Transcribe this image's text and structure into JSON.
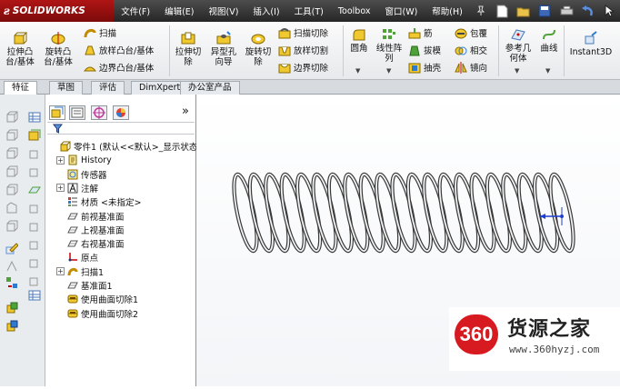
{
  "app": {
    "logo_text": "SOLIDWORKS",
    "menus": [
      "文件(F)",
      "编辑(E)",
      "视图(V)",
      "插入(I)",
      "工具(T)",
      "Toolbox",
      "窗口(W)",
      "帮助(H)"
    ]
  },
  "ribbon": {
    "extrude_boss": "拉伸凸\n台/基体",
    "revolve_boss": "旋转凸\n台/基体",
    "sweep": "扫描",
    "loft_boss": "放样凸台/基体",
    "boundary_boss": "边界凸台/基体",
    "extrude_cut": "拉伸切\n除",
    "hole_wizard": "异型孔\n向导",
    "revolve_cut": "旋转切\n除",
    "sweep_cut": "扫描切除",
    "loft_cut": "放样切割",
    "boundary_cut": "边界切除",
    "fillet": "圆角",
    "linear_pattern": "线性阵\n列",
    "rib": "筋",
    "draft": "拔模",
    "shell": "抽壳",
    "wrap": "包覆",
    "intersect": "相交",
    "mirror": "镜向",
    "ref_geometry": "参考几\n何体",
    "curves": "曲线",
    "instant3d": "Instant3D"
  },
  "tabs": [
    "特征",
    "草图",
    "评估",
    "DimXpert",
    "办公室产品"
  ],
  "panel": {
    "expand_glyph": "»",
    "tree": [
      {
        "label": "零件1  (默认<<默认>_显示状态",
        "icon": "part-icon",
        "expand": "",
        "indent": 0
      },
      {
        "label": "History",
        "icon": "history-icon",
        "expand": "+",
        "indent": 1
      },
      {
        "label": "传感器",
        "icon": "sensor-icon",
        "expand": "",
        "indent": 1
      },
      {
        "label": "注解",
        "icon": "annotation-icon",
        "expand": "+",
        "indent": 1
      },
      {
        "label": "材质 <未指定>",
        "icon": "material-icon",
        "expand": "",
        "indent": 1
      },
      {
        "label": "前视基准面",
        "icon": "plane-icon",
        "expand": "",
        "indent": 1
      },
      {
        "label": "上视基准面",
        "icon": "plane-icon",
        "expand": "",
        "indent": 1
      },
      {
        "label": "右视基准面",
        "icon": "plane-icon",
        "expand": "",
        "indent": 1
      },
      {
        "label": "原点",
        "icon": "origin-icon",
        "expand": "",
        "indent": 1
      },
      {
        "label": "扫描1",
        "icon": "sweep-feature-icon",
        "expand": "+",
        "indent": 1
      },
      {
        "label": "基准面1",
        "icon": "plane-icon",
        "expand": "",
        "indent": 1
      },
      {
        "label": "使用曲面切除1",
        "icon": "surface-cut-icon",
        "expand": "",
        "indent": 1
      },
      {
        "label": "使用曲面切除2",
        "icon": "surface-cut-icon",
        "expand": "",
        "indent": 1
      }
    ]
  },
  "model": {
    "type": "spring",
    "coil_count": 21,
    "color_edge": "#3a3a3a"
  },
  "watermark": {
    "badge": "360",
    "title": "货源之家",
    "url": "www.360hyzj.com"
  }
}
